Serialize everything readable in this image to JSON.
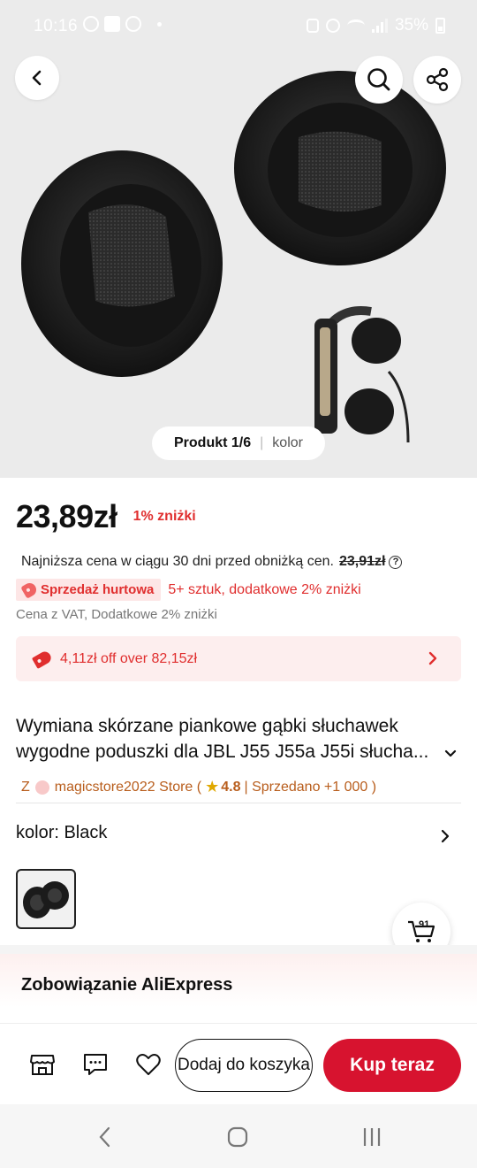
{
  "status_bar": {
    "time": "10:16",
    "battery": "35%"
  },
  "hero": {
    "pager_count": "Produkt 1/6",
    "pager_separator": "|",
    "pager_label": "kolor"
  },
  "price": {
    "current": "23,89zł",
    "discount": "1% zniżki",
    "lowest_label": "Najniższa cena w ciągu 30 dni przed obniżką cen.",
    "lowest_old": "23,91zł",
    "help_symbol": "?"
  },
  "wholesale": {
    "tag": "Sprzedaż hurtowa",
    "text": "5+ sztuk, dodatkowe 2% zniżki"
  },
  "vat_note": "Cena z VAT, Dodatkowe 2% zniżki",
  "coupon": {
    "text": "4,11zł off over 82,15zł"
  },
  "product": {
    "title_line1": "Wymiana skórzane piankowe gąbki słuchawek",
    "title_line2": "wygodne poduszki dla JBL J55 J55a J55i słucha..."
  },
  "store": {
    "prefix": "Z",
    "name": "magicstore2022 Store (",
    "star": "★",
    "rating": "4.8",
    "sold": "| Sprzedano +1 000 )"
  },
  "color": {
    "label": "kolor: Black"
  },
  "cart": {
    "count": "91"
  },
  "commitment": {
    "label": "Zobowiązanie AliExpress"
  },
  "actions": {
    "add_to_cart": "Dodaj do koszyka",
    "buy_now": "Kup teraz"
  },
  "theme": {
    "accent": "#d7132f",
    "red_text": "#e02e2e",
    "store_color": "#b85d1c"
  }
}
